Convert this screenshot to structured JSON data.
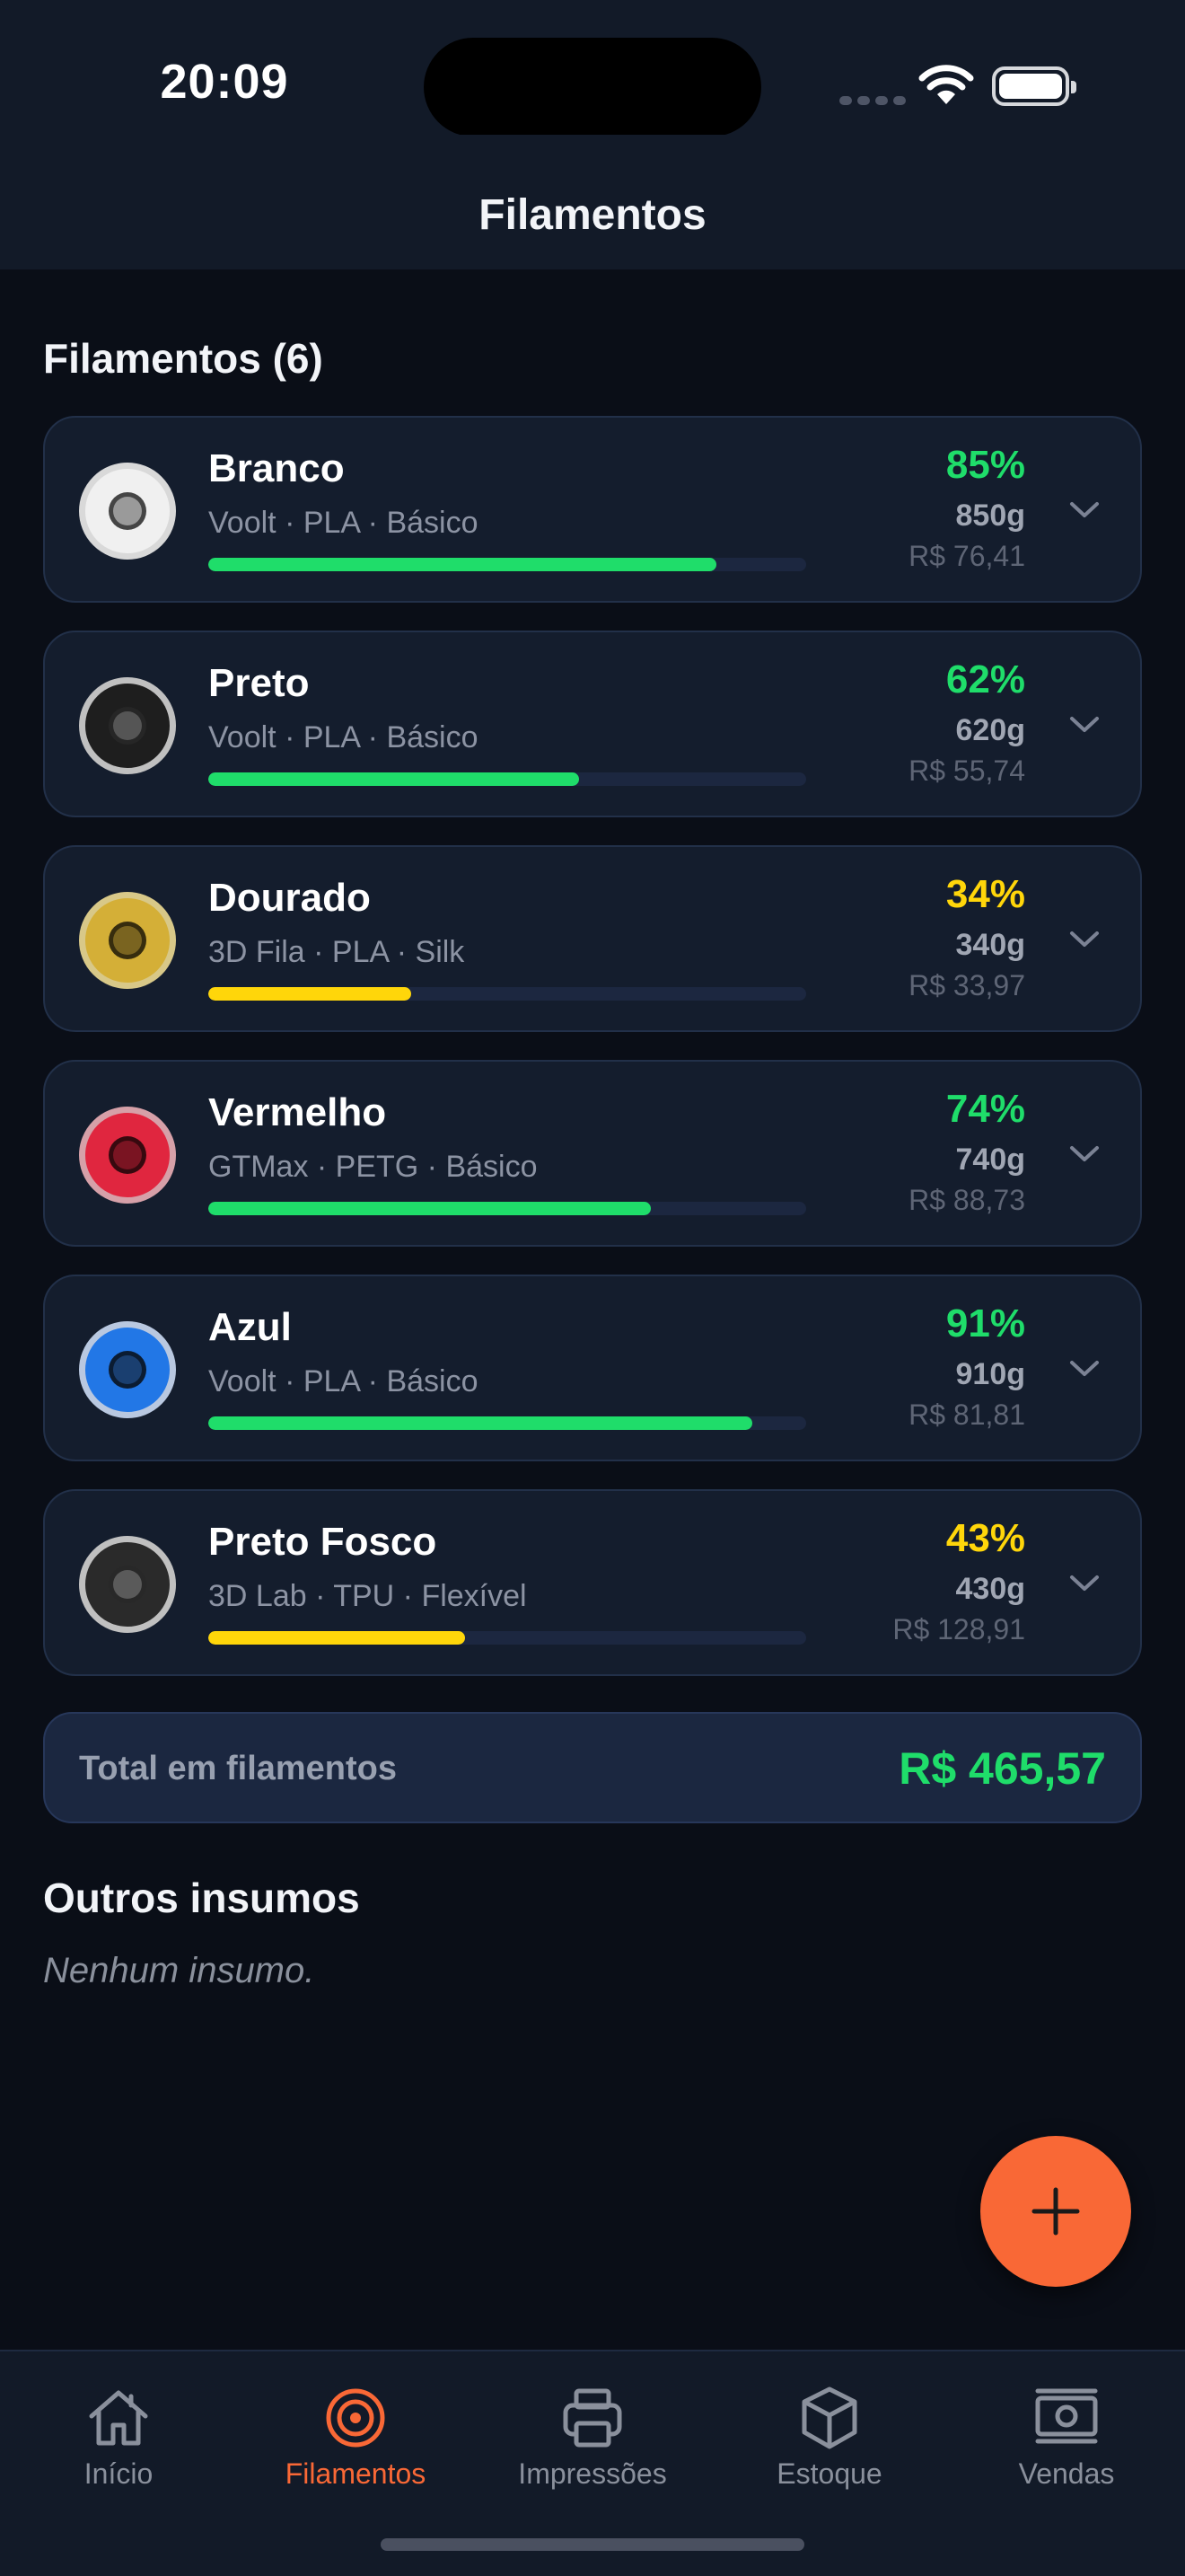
{
  "status_bar": {
    "time": "20:09"
  },
  "header": {
    "title": "Filamentos"
  },
  "filaments_section": {
    "title": "Filamentos (6)"
  },
  "filaments": [
    {
      "name": "Branco",
      "meta": "Voolt · PLA · Básico",
      "percent": "85%",
      "level": 0.85,
      "weight": "850g",
      "price": "R$ 76,41",
      "spool_color": "#f0f0f0",
      "ring_color": "#d9d9d9",
      "core_color": "#9a9a9a",
      "status_color": "#1fdd6a"
    },
    {
      "name": "Preto",
      "meta": "Voolt · PLA · Básico",
      "percent": "62%",
      "level": 0.62,
      "weight": "620g",
      "price": "R$ 55,74",
      "spool_color": "#1e1e1e",
      "ring_color": "#c0c0c0",
      "core_color": "#555555",
      "status_color": "#1fdd6a"
    },
    {
      "name": "Dourado",
      "meta": "3D Fila · PLA · Silk",
      "percent": "34%",
      "level": 0.34,
      "weight": "340g",
      "price": "R$ 33,97",
      "spool_color": "#d4af37",
      "ring_color": "#d8c888",
      "core_color": "#7a6420",
      "status_color": "#ffd60a"
    },
    {
      "name": "Vermelho",
      "meta": "GTMax · PETG · Básico",
      "percent": "74%",
      "level": 0.74,
      "weight": "740g",
      "price": "R$ 88,73",
      "spool_color": "#e0263f",
      "ring_color": "#d6a0a8",
      "core_color": "#7a1422",
      "status_color": "#1fdd6a"
    },
    {
      "name": "Azul",
      "meta": "Voolt · PLA · Básico",
      "percent": "91%",
      "level": 0.91,
      "weight": "910g",
      "price": "R$ 81,81",
      "spool_color": "#2277e6",
      "ring_color": "#b9c8e0",
      "core_color": "#1a3f70",
      "status_color": "#1fdd6a"
    },
    {
      "name": "Preto Fosco",
      "meta": "3D Lab · TPU · Flexível",
      "percent": "43%",
      "level": 0.43,
      "weight": "430g",
      "price": "R$ 128,91",
      "spool_color": "#2a2a2a",
      "ring_color": "#c0c0c0",
      "core_color": "#5a5a5a",
      "status_color": "#ffd60a"
    }
  ],
  "total": {
    "label": "Total em filamentos",
    "value": "R$ 465,57"
  },
  "other_supplies": {
    "title": "Outros insumos",
    "empty": "Nenhum insumo."
  },
  "fab": {
    "icon": "plus-icon"
  },
  "tabs": [
    {
      "label": "Início",
      "icon": "home-icon",
      "active": false
    },
    {
      "label": "Filamentos",
      "icon": "spool-icon",
      "active": true
    },
    {
      "label": "Impressões",
      "icon": "printer-icon",
      "active": false
    },
    {
      "label": "Estoque",
      "icon": "box-icon",
      "active": false
    },
    {
      "label": "Vendas",
      "icon": "banknote-icon",
      "active": false
    }
  ],
  "colors": {
    "accent": "#f96836",
    "ok": "#1fdd6a",
    "warn": "#ffd60a",
    "background": "#0a0e17",
    "card": "#141d2d"
  }
}
